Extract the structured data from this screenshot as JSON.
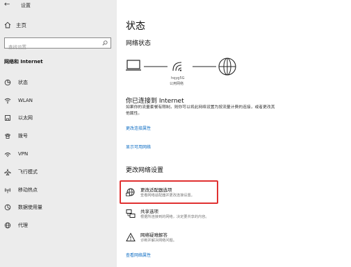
{
  "window": {
    "title": "设置",
    "back_glyph": "←",
    "minimize_glyph": "—"
  },
  "sidebar": {
    "home_label": "主页",
    "search_placeholder": "查找设置",
    "section_title": "网络和 Internet",
    "items": [
      {
        "label": "状态",
        "icon": "status-icon"
      },
      {
        "label": "WLAN",
        "icon": "wifi-icon"
      },
      {
        "label": "以太网",
        "icon": "ethernet-icon"
      },
      {
        "label": "拨号",
        "icon": "dialup-icon"
      },
      {
        "label": "VPN",
        "icon": "vpn-icon"
      },
      {
        "label": "飞行模式",
        "icon": "airplane-icon"
      },
      {
        "label": "移动热点",
        "icon": "hotspot-icon"
      },
      {
        "label": "数据使用量",
        "icon": "data-usage-icon"
      },
      {
        "label": "代理",
        "icon": "proxy-icon"
      }
    ]
  },
  "main": {
    "title": "状态",
    "network_status_heading": "网络状态",
    "ssid": "hqyg5G",
    "network_type": "公用网络",
    "connected_heading": "你已连接到 Internet",
    "connected_description": "如果你的流量套餐有限制，则你可以将此网络设置为按流量计费的连接，或者更改其他属性。",
    "change_properties_link": "更改连接属性",
    "show_available_link": "显示可用网络",
    "change_settings_heading": "更改网络设置",
    "options": [
      {
        "title": "更改适配器选项",
        "description": "查看网络适配器并更改连接设置。",
        "icon": "adapter-icon"
      },
      {
        "title": "共享选项",
        "description": "根据所连接到的网络，决定要共享的内容。",
        "icon": "sharing-icon"
      },
      {
        "title": "网络疑难解答",
        "description": "诊断并解决网络问题。",
        "icon": "warning-icon"
      }
    ],
    "view_properties_link": "查看网络属性"
  },
  "colors": {
    "sidebar_bg": "#ececec",
    "link": "#0f6ec4",
    "highlight": "#e03030"
  }
}
